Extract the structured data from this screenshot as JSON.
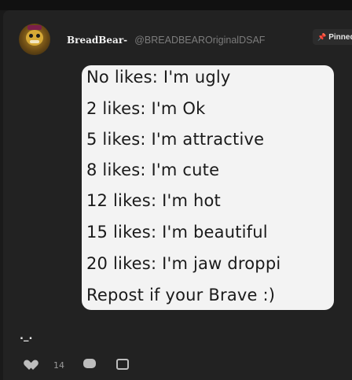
{
  "post": {
    "author": {
      "display_name": "BreadBear-",
      "handle": "@BREADBEAROriginalDSAF"
    },
    "pinned_label": "Pinned",
    "image_text_lines": [
      "No likes: I'm ugly",
      "2 likes: I'm Ok",
      "5 likes: I'm attractive",
      "8 likes: I'm cute",
      "12 likes: I'm hot",
      "15 likes: I'm beautiful",
      "20 likes: I'm jaw droppi",
      "Repost if your Brave :)"
    ],
    "caption": "._.",
    "like_count": "14"
  },
  "icons": [
    "pin-icon",
    "heart-icon",
    "comment-icon",
    "share-icon"
  ],
  "colors": {
    "background": "#1a1a1a",
    "card": "#222222",
    "handle": "#7c7c7c"
  }
}
